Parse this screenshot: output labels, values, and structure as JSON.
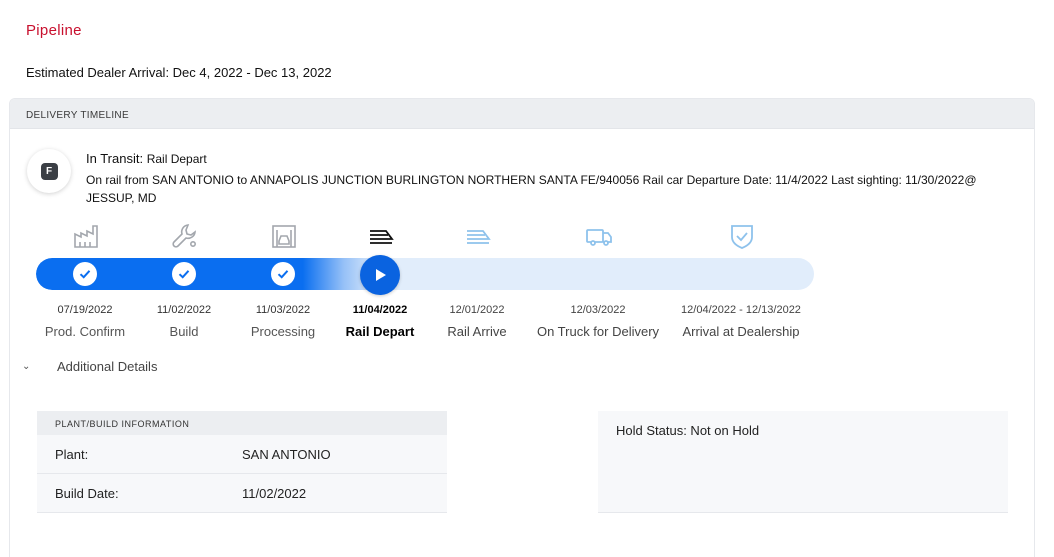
{
  "page": {
    "title": "Pipeline",
    "arrival": "Estimated Dealer Arrival: Dec 4, 2022 - Dec 13, 2022"
  },
  "timeline": {
    "header": "DELIVERY TIMELINE",
    "badge_letter": "F",
    "status_label": "In Transit:",
    "status_value": "Rail Depart",
    "description": "On rail from SAN ANTONIO to ANNAPOLIS JUNCTION BURLINGTON NORTHERN SANTA FE/940056 Rail car Departure Date: 11/4/2022 Last sighting: 11/30/2022@ JESSUP, MD",
    "progress_fraction": 0.44,
    "stages": [
      {
        "name": "Prod. Confirm",
        "date": "07/19/2022",
        "state": "complete",
        "icon": "factory-icon"
      },
      {
        "name": "Build",
        "date": "11/02/2022",
        "state": "complete",
        "icon": "wrench-icon"
      },
      {
        "name": "Processing",
        "date": "11/03/2022",
        "state": "complete",
        "icon": "vehicle-processing-icon"
      },
      {
        "name": "Rail Depart",
        "date": "11/04/2022",
        "state": "active",
        "icon": "train-icon"
      },
      {
        "name": "Rail Arrive",
        "date": "12/01/2022",
        "state": "future",
        "icon": "train-arrive-icon"
      },
      {
        "name": "On Truck for Delivery",
        "date": "12/03/2022",
        "state": "future",
        "icon": "truck-icon"
      },
      {
        "name": "Arrival at Dealership",
        "date": "12/04/2022 - 12/13/2022",
        "state": "future",
        "icon": "shield-check-icon"
      }
    ]
  },
  "details": {
    "toggle_label": "Additional Details",
    "plant_header": "PLANT/BUILD INFORMATION",
    "rows": [
      {
        "key": "Plant:",
        "value": "SAN ANTONIO"
      },
      {
        "key": "Build Date:",
        "value": "11/02/2022"
      }
    ],
    "hold_status": "Hold Status: Not on Hold"
  },
  "colors": {
    "brand_red": "#c8102e",
    "progress_blue": "#0a6ef0",
    "track_light": "#e1edfb",
    "icon_done": "#a3a7ad",
    "icon_future": "#8ec2ec"
  }
}
